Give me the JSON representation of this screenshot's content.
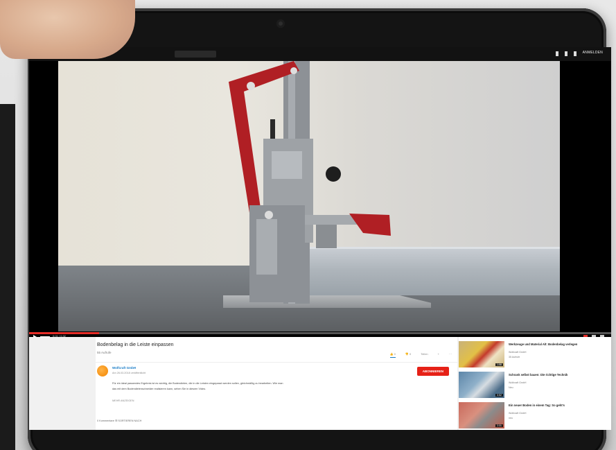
{
  "topbar": {
    "signin": "ANMELDEN"
  },
  "video": {
    "time": "0:01 / 0:32",
    "progress": 0.12
  },
  "watch": {
    "title": "Bodenbelag in die Leiste einpassen",
    "views": "55 Aufrufe",
    "actions": [
      "👍 0",
      "👎 0",
      "Teilen",
      "+",
      "···"
    ],
    "channel": "Wolfcraft GmbH",
    "published": "Am 26.03.2018 veröffentlicht",
    "subscribe": "ABONNIEREN",
    "description": "Für ein ideal passendes Ergebnis ist es wichtig, die Bodendielen, die in die Leisten eingepasst werden sollen, gleichmäßig zu bearbeiten. Wie man das mit dem Bodendielenschneider realisieren kann, sehen Sie in diesem Video.",
    "more": "MEHR ANZEIGEN",
    "comments": "0 Kommentare    ☰ SORTIEREN NACH"
  },
  "related": [
    {
      "title": "Werkzeuge und Material Alt: Bodenbelag verlegen",
      "channel": "Wolfcraft GmbH",
      "views": "35 Aufrufe",
      "duration": "1:58"
    },
    {
      "title": "Schrank selbst bauen: Die richtige Technik",
      "channel": "Wolfcraft GmbH",
      "views": "Neu",
      "duration": "0:52"
    },
    {
      "title": "Ein neuer Boden in einem Tag: So geht's",
      "channel": "Wolfcraft GmbH",
      "views": "neu",
      "duration": "2:31"
    }
  ]
}
